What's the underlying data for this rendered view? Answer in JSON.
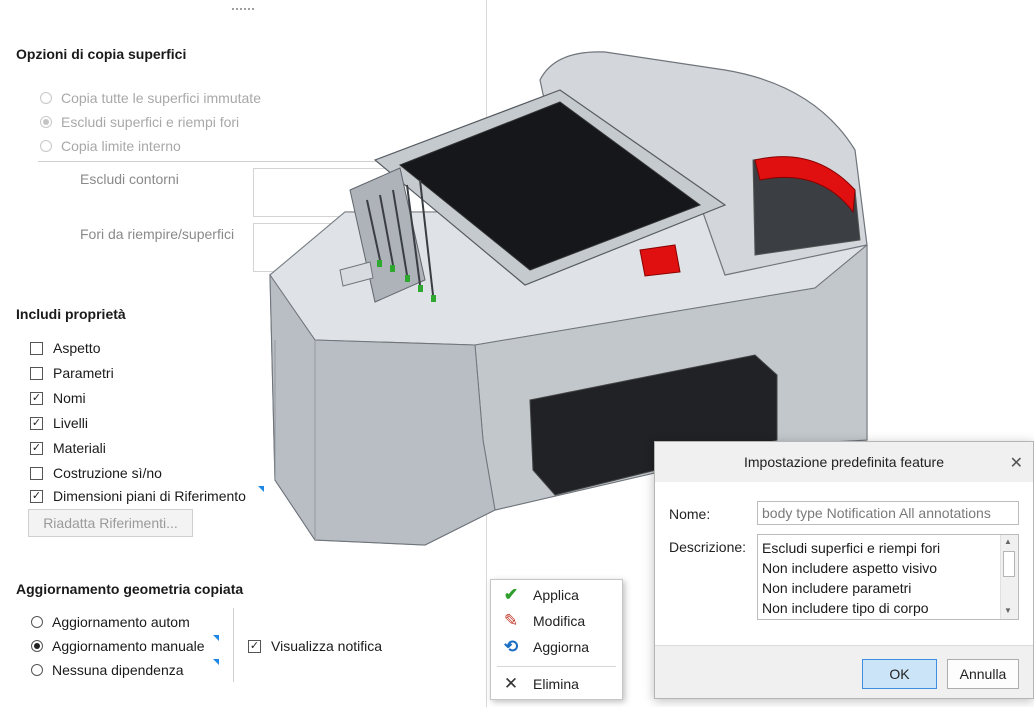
{
  "surface_copy": {
    "title": "Opzioni di copia superfici",
    "options": [
      {
        "label": "Copia tutte le superfici immutate",
        "checked": false
      },
      {
        "label": "Escludi superfici e riempi fori",
        "checked": true
      },
      {
        "label": "Copia limite interno",
        "checked": false
      }
    ],
    "fields": [
      {
        "label": "Escludi contorni",
        "value": ""
      },
      {
        "label": "Fori da riempire/superfici",
        "value": ""
      }
    ]
  },
  "properties": {
    "title": "Includi proprietà",
    "items": [
      {
        "label": "Aspetto",
        "checked": false
      },
      {
        "label": "Parametri",
        "checked": false
      },
      {
        "label": "Nomi",
        "checked": true
      },
      {
        "label": "Livelli",
        "checked": true
      },
      {
        "label": "Materiali",
        "checked": true
      },
      {
        "label": "Costruzione sì/no",
        "checked": false
      },
      {
        "label": "Dimensioni piani di Riferimento",
        "checked": true
      }
    ],
    "refit_button": "Riadatta Riferimenti..."
  },
  "geometry_update": {
    "title": "Aggiornamento geometria copiata",
    "options": [
      {
        "label": "Aggiornamento autom",
        "checked": false
      },
      {
        "label": "Aggiornamento manuale",
        "checked": true
      },
      {
        "label": "Nessuna dipendenza",
        "checked": false
      }
    ],
    "notify_label": "Visualizza notifica",
    "notify_checked": true
  },
  "context_menu": {
    "items": [
      {
        "label": "Applica",
        "icon": "checkmark-icon"
      },
      {
        "label": "Modifica",
        "icon": "pencil-icon"
      },
      {
        "label": "Aggiorna",
        "icon": "refresh-icon"
      },
      {
        "label": "Elimina",
        "icon": "delete-x-icon"
      }
    ]
  },
  "dialog": {
    "title": "Impostazione predefinita feature",
    "name_label": "Nome:",
    "name_value": "body type Notification All annotations",
    "description_label": "Descrizione:",
    "description_lines": [
      "Escludi superfici e riempi fori",
      "Non includere aspetto visivo",
      "Non includere parametri",
      "Non includere tipo di corpo"
    ],
    "ok_label": "OK",
    "cancel_label": "Annulla"
  },
  "colors": {
    "accent_blue": "#1e88e5",
    "ok_button_bg": "#cce4f7",
    "model_red": "#e01010",
    "model_green": "#2fa82f"
  }
}
